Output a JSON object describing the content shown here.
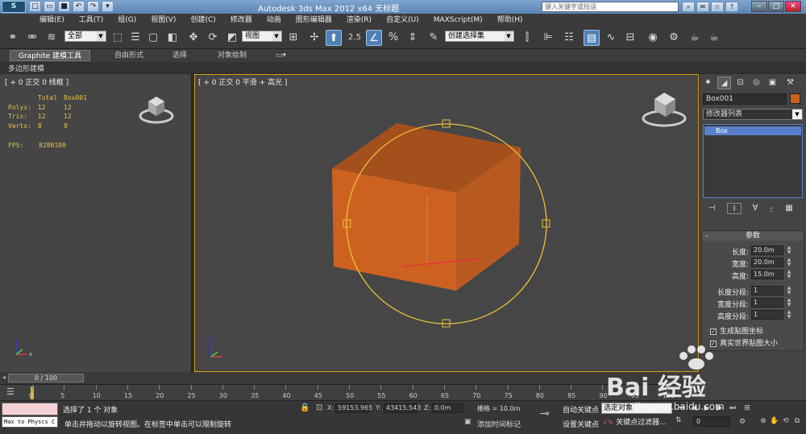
{
  "titlebar": {
    "title": "Autodesk 3ds Max  2012 x64      无标题",
    "search_placeholder": "键入关键字或短语",
    "logo_icon": "3dsmax-logo-icon",
    "quick_access": [
      "new-icon",
      "open-icon",
      "save-icon",
      "undo-icon",
      "redo-icon",
      "dropdown-icon"
    ]
  },
  "menu": [
    "编辑(E)",
    "工具(T)",
    "组(G)",
    "视图(V)",
    "创建(C)",
    "修改器",
    "动画",
    "图形编辑器",
    "渲染(R)",
    "自定义(U)",
    "MAXScript(M)",
    "帮助(H)"
  ],
  "toolbar": {
    "selection_filter": "全部",
    "ref_coord": "视图",
    "snap_value": "2.5",
    "named_selection": "创建选择集"
  },
  "ribbon": {
    "tabs": [
      "Graphite 建模工具",
      "自由形式",
      "选择",
      "对象绘制"
    ],
    "sub": "多边形建模"
  },
  "viewport_left": {
    "label": "[ + 0 正交 0 线框 ]",
    "stats": {
      "header": [
        "Total",
        "Box001"
      ],
      "rows": [
        [
          "Polys:",
          "12",
          "12"
        ],
        [
          "Tris:",
          "12",
          "12"
        ],
        [
          "Verts:",
          "8",
          "8"
        ]
      ],
      "fps_label": "FPS:",
      "fps_value": "8288100"
    }
  },
  "viewport_main": {
    "label": "[ + 0 正交 0 平滑 + 高光 ]",
    "object_color": "#cd6220"
  },
  "command_panel": {
    "object_name": "Box001",
    "object_color": "#cd6220",
    "modifier_list": "修改器列表",
    "stack_item": "Box",
    "params_title": "参数",
    "params": [
      {
        "label": "长度:",
        "value": "20.0m"
      },
      {
        "label": "宽度:",
        "value": "20.0m"
      },
      {
        "label": "高度:",
        "value": "15.0m"
      }
    ],
    "segments": [
      {
        "label": "长度分段:",
        "value": "1"
      },
      {
        "label": "宽度分段:",
        "value": "1"
      },
      {
        "label": "高度分段:",
        "value": "1"
      }
    ],
    "checks": [
      {
        "label": "生成贴图坐标",
        "checked": true
      },
      {
        "label": "真实世界贴图大小",
        "checked": true
      }
    ]
  },
  "timeline": {
    "slider": "0 / 100",
    "ticks": [
      "0",
      "5",
      "10",
      "15",
      "20",
      "25",
      "30",
      "35",
      "40",
      "45",
      "50",
      "55",
      "60",
      "65",
      "70",
      "75",
      "80",
      "85",
      "90",
      "95",
      "100"
    ]
  },
  "status": {
    "maxscript": "Max to Physcs C",
    "selected": "选择了 1 个 对象",
    "hint": "单击并拖动以旋转视图。在标签中单击可以限制旋转",
    "x_label": "X:",
    "x": "59153.965",
    "y_label": "Y:",
    "y": "43415.543",
    "z_label": "Z:",
    "z": "0.0m",
    "grid": "栅格 = 10.0m",
    "add_time_tag": "添加时间标记",
    "auto_key": "自动关键点",
    "set_key": "设置关键点",
    "selection_set": "选定对象",
    "key_filter": "关键点过滤器...",
    "frame": "0"
  },
  "watermark": {
    "text": "Bai 经验",
    "url": "jingyan.baidu.com"
  }
}
